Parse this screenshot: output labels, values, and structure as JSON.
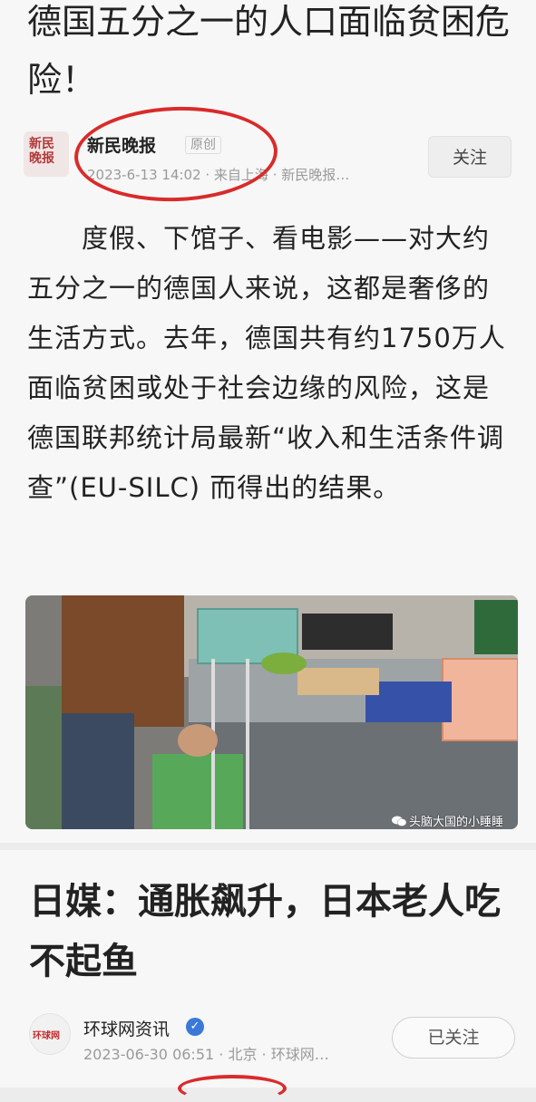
{
  "article1": {
    "title": "德国五分之一的人口面临贫困危险！",
    "source": "新民晚报",
    "logo_text": "新民晚报",
    "original_tag": "原创",
    "meta": "2023-6-13 14:02 · 来自上海 · 新民晚报…",
    "follow_label": "关注",
    "body": "　　度假、下馆子、看电影——对大约五分之一的德国人来说，这都是奢侈的生活方式。去年，德国共有约1750万人面临贫困或处于社会边缘的风险，这是德国联邦统计局最新“收入和生活条件调查”(EU-SILC) 而得出的结果。",
    "watermark": "头脑大国的小睡睡"
  },
  "article2": {
    "title": "日媒：通胀飙升，日本老人吃不起鱼",
    "source": "环球网资讯",
    "logo_text": "环球网",
    "meta": "2023-06-30 06:51 · 北京 · 环球网…",
    "followed_label": "已关注"
  },
  "colors": {
    "highlight_red": "#d92b2b",
    "verified_blue": "#3b78d8",
    "logo_red": "#b23a3a"
  }
}
